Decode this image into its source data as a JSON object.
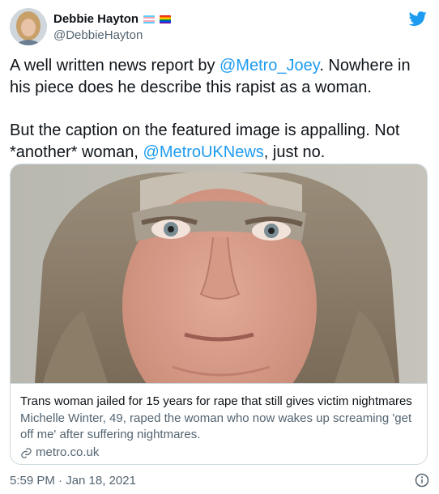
{
  "user": {
    "display_name": "Debbie Hayton",
    "handle": "@DebbieHayton",
    "flags": [
      "transgender-flag",
      "rainbow-flag"
    ]
  },
  "tweet": {
    "line1_prefix": "A well written news report by ",
    "line1_mention": "@Metro_Joey",
    "line1_suffix": ". Nowhere in his piece does he describe this rapist as a woman.",
    "line2_prefix": "But the caption on the featured image is appalling. Not *another* woman, ",
    "line2_mention": "@MetroUKNews",
    "line2_suffix": ", just no."
  },
  "card": {
    "image_subject": "police mugshot photo",
    "title": "Trans woman jailed for 15 years for rape that still gives victim nightmares",
    "description": "Michelle Winter, 49, raped the woman who now wakes up screaming 'get off me' after suffering nightmares.",
    "domain": "metro.co.uk",
    "domain_icon": "link-icon"
  },
  "meta": {
    "timestamp": "5:59 PM · Jan 18, 2021"
  },
  "icons": {
    "brand": "twitter-bird-icon",
    "info": "info-icon"
  },
  "colors": {
    "link": "#1d9bf0",
    "secondary_text": "#536471",
    "border": "#cfd9de"
  }
}
